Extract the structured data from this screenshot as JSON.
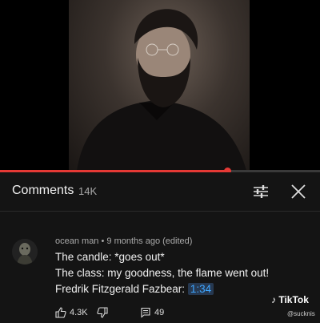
{
  "comments": {
    "title": "Comments",
    "count": "14K"
  },
  "progress": {
    "fraction": 0.71
  },
  "comment": {
    "author": "ocean man",
    "time": "9 months ago (edited)",
    "lines": [
      "The candle: *goes out*",
      "The class: my goodness, the flame went out!",
      "Fredrik Fitzgerald Fazbear:"
    ],
    "timestamp": "1:34",
    "likes": "4.3K",
    "replies": "49"
  },
  "watermark": {
    "brand": "TikTok",
    "user": "@sucknis"
  },
  "icons": {
    "filter": "sliders-icon",
    "close": "close-icon",
    "like": "thumbs-up-icon",
    "dislike": "thumbs-down-icon",
    "reply": "comment-bubble-icon",
    "brand": "music-note-icon"
  },
  "colors": {
    "accent": "#e53935",
    "link": "#3ea6ff"
  }
}
